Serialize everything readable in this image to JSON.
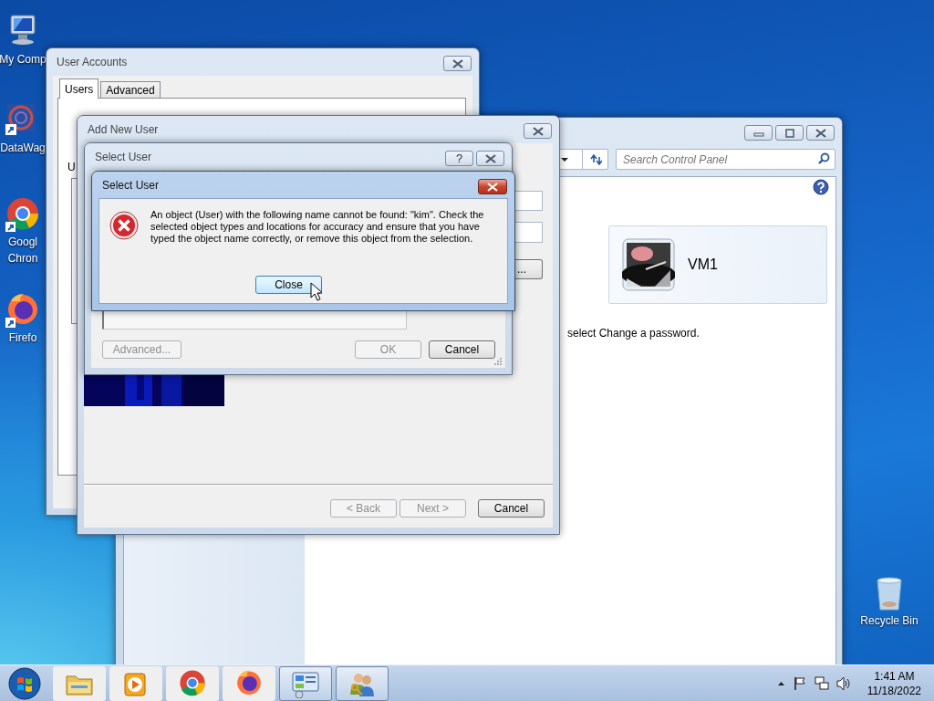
{
  "desktop_icons": [
    {
      "kind": "computer",
      "label_lines": [
        "My Comp"
      ]
    },
    {
      "kind": "datawag",
      "label_lines": [
        "DataWag"
      ]
    },
    {
      "kind": "chrome",
      "label_lines": [
        "Googl",
        "Chron"
      ]
    },
    {
      "kind": "firefox",
      "label_lines": [
        "Firefo"
      ]
    }
  ],
  "recycle_bin": {
    "label": "Recycle Bin"
  },
  "control_panel": {
    "search": {
      "placeholder": "Search Control Panel"
    },
    "account": {
      "name": "VM1"
    },
    "hint": "select Change a password."
  },
  "user_accounts": {
    "title": "User Accounts",
    "tabs": [
      {
        "label": "Users",
        "selected": true
      },
      {
        "label": "Advanced",
        "selected": false
      }
    ],
    "label": "U"
  },
  "add_new_user": {
    "title": "Add New User",
    "browse_button": "...",
    "buttons": [
      {
        "label": "< Back",
        "disabled": true
      },
      {
        "label": "Next >",
        "disabled": true
      },
      {
        "label": "Cancel",
        "disabled": false
      }
    ]
  },
  "select_user": {
    "title": "Select User",
    "help": "?",
    "buttons": [
      {
        "label": "Advanced...",
        "disabled": true
      },
      {
        "label": "OK",
        "disabled": true
      },
      {
        "label": "Cancel",
        "disabled": false
      }
    ]
  },
  "error_dialog": {
    "title": "Select User",
    "message": "An object (User) with the following name cannot be found: \"kim\". Check the selected object types and locations for accuracy and ensure that you have typed the object name correctly, or remove this object from the selection.",
    "button": "Close"
  },
  "taskbar": {
    "apps": [
      {
        "kind": "explorer",
        "active": false
      },
      {
        "kind": "media",
        "active": false
      },
      {
        "kind": "chrome",
        "active": false
      },
      {
        "kind": "firefox",
        "active": false
      },
      {
        "kind": "control-panel",
        "active": true
      },
      {
        "kind": "users",
        "active": true
      }
    ],
    "time": "1:41 AM",
    "date": "11/18/2022"
  }
}
